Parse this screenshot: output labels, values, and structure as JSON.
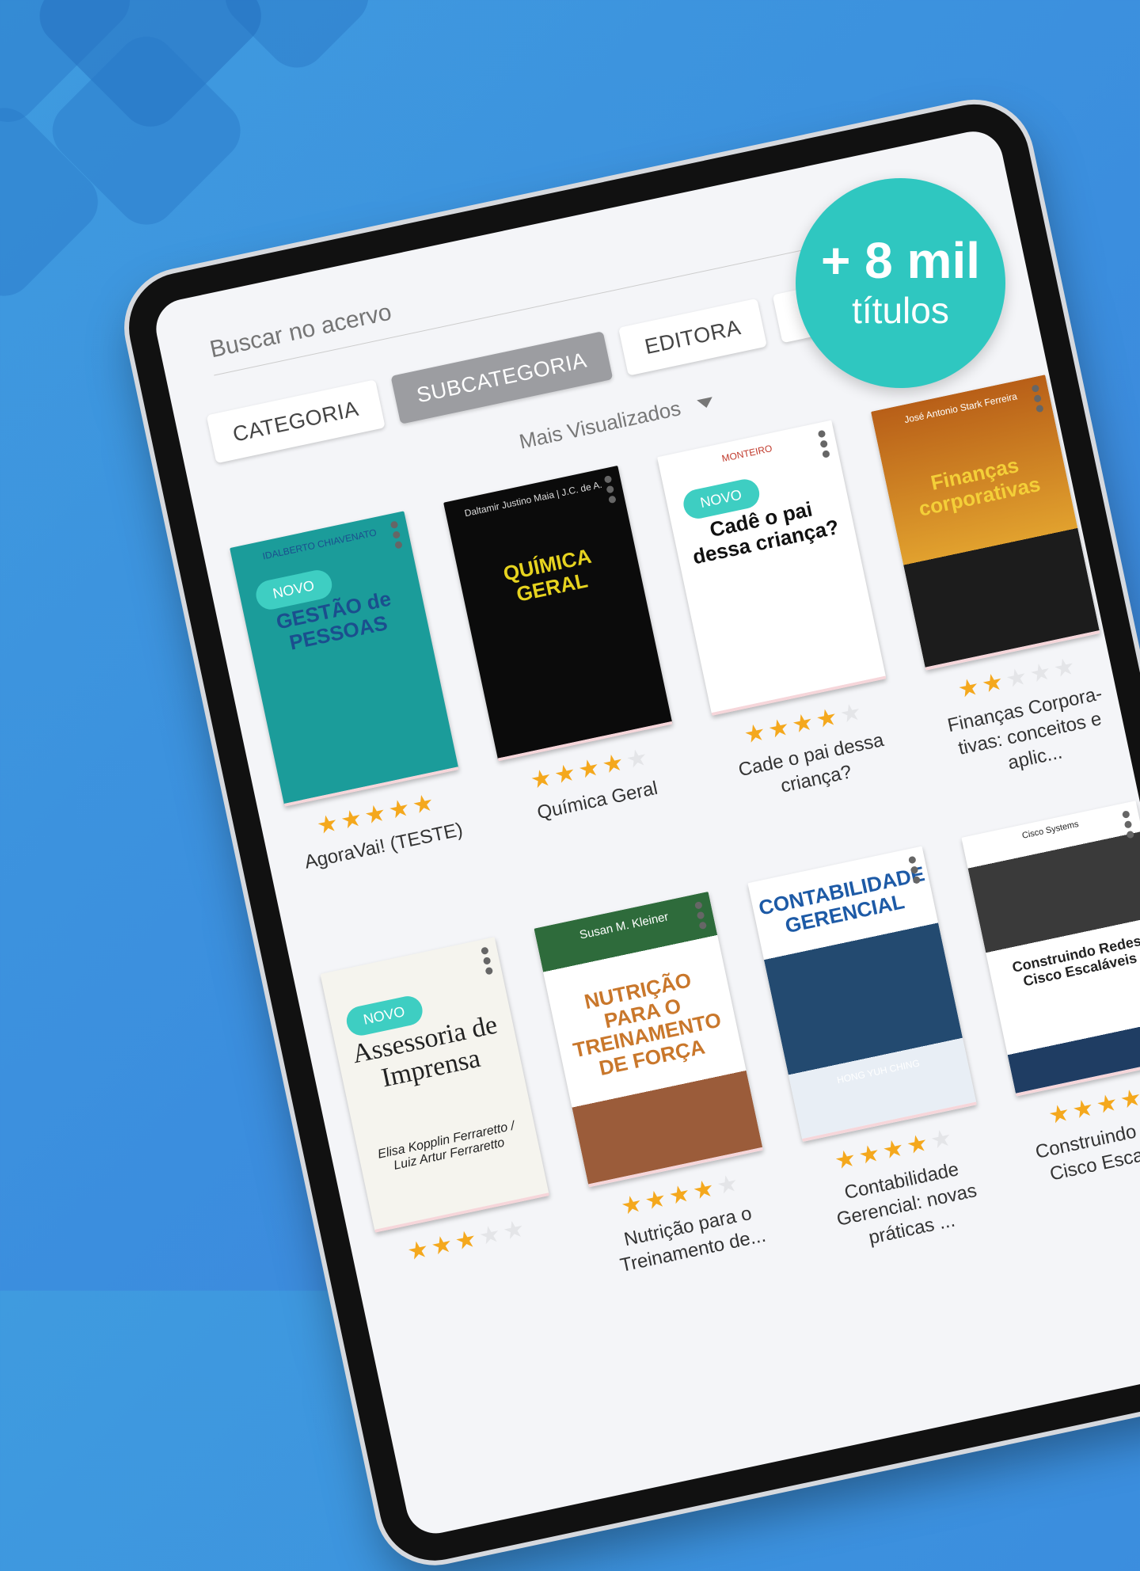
{
  "search": {
    "placeholder": "Buscar no acervo"
  },
  "filters": [
    {
      "label": "CATEGORIA",
      "active": false
    },
    {
      "label": "SUBCATEGORIA",
      "active": true
    },
    {
      "label": "EDITORA",
      "active": false
    },
    {
      "label": "★★★★★",
      "active": false
    }
  ],
  "sort": {
    "label": "Mais Visualizados"
  },
  "promo": {
    "line1": "+ 8 mil",
    "line2": "títulos"
  },
  "books": [
    {
      "title": "AgoraVai! (TESTE)",
      "rating": 5,
      "badge": "NOVO",
      "cover_author": "IDALBERTO CHIAVENATO",
      "cover_title": "GESTÃO de PESSOAS"
    },
    {
      "title": "Química Geral",
      "rating": 4,
      "badge": "",
      "cover_author": "Daltamir Justino Maia | J.C. de A.",
      "cover_title": "QUÍMICA GERAL"
    },
    {
      "title": "Cade o pai dessa criança?",
      "rating": 4,
      "badge": "NOVO",
      "cover_author": "MONTEIRO",
      "cover_title": "Cadê o pai dessa criança?"
    },
    {
      "title": "Finanças Corpora-tivas: conceitos e aplic...",
      "rating": 2,
      "badge": "",
      "cover_author": "José Antonio Stark Ferreira",
      "cover_title": "Finanças corporativas"
    },
    {
      "title": "",
      "rating": 3,
      "badge": "NOVO",
      "cover_author": "Elisa Kopplin Ferraretto / Luiz Artur Ferraretto",
      "cover_title": "Assessoria de Imprensa"
    },
    {
      "title": "Nutrição para o Treinamento de...",
      "rating": 4,
      "badge": "",
      "cover_author": "Susan M. Kleiner",
      "cover_title": "NUTRIÇÃO PARA O TREINAMENTO DE FORÇA"
    },
    {
      "title": "Contabilidade Gerencial: novas práticas ...",
      "rating": 4,
      "badge": "",
      "cover_author": "HONG YUH CHING",
      "cover_title": "CONTABILIDADE GERENCIAL"
    },
    {
      "title": "Construindo Redes Cisco Escaláveis",
      "rating": 5,
      "badge": "",
      "cover_author": "Cisco Systems",
      "cover_title": "Construindo Redes Cisco Escaláveis"
    }
  ],
  "colors": {
    "accent": "#2fc7c0",
    "star": "#f4a81d",
    "background": "#3b8ede"
  }
}
